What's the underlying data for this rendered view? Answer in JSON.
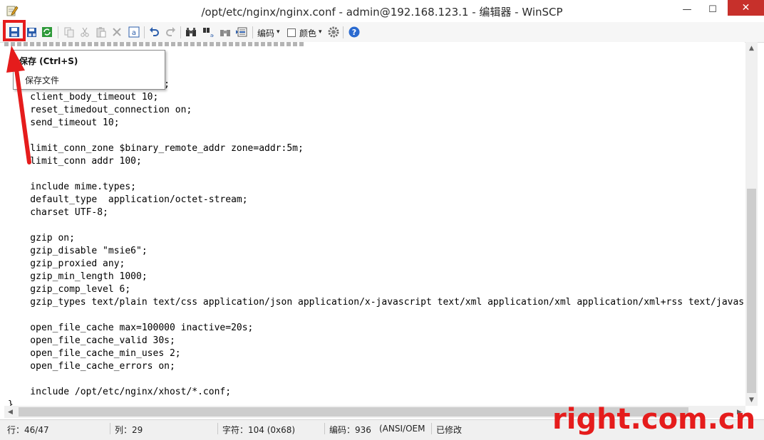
{
  "window": {
    "title": "/opt/etc/nginx/nginx.conf - admin@192.168.123.1 - 编辑器 - WinSCP",
    "minimize_glyph": "—",
    "maximize_glyph": "☐",
    "close_glyph": "✕"
  },
  "toolbar": {
    "icons": [
      "save-icon",
      "save-as-icon",
      "reload-icon",
      "copy-icon",
      "cut-icon",
      "paste-icon",
      "delete-icon",
      "select-all-icon",
      "undo-icon",
      "redo-icon",
      "find-icon",
      "replace-icon",
      "find-next-icon",
      "goto-line-icon",
      "settings-icon",
      "help-icon"
    ],
    "encoding_label": "编码",
    "color_label": "颜色",
    "dropdown_glyph": "▾",
    "accent_color": "#2a5caa"
  },
  "tooltip": {
    "title": "保存 (Ctrl+S)",
    "description": "保存文件"
  },
  "editor": {
    "code": "    client_header_timeout 10;\n    client_body_timeout 10;\n    reset_timedout_connection on;\n    send_timeout 10;\n\n    limit_conn_zone $binary_remote_addr zone=addr:5m;\n    limit_conn addr 100;\n\n    include mime.types;\n    default_type  application/octet-stream;\n    charset UTF-8;\n\n    gzip on;\n    gzip_disable \"msie6\";\n    gzip_proxied any;\n    gzip_min_length 1000;\n    gzip_comp_level 6;\n    gzip_types text/plain text/css application/json application/x-javascript text/xml application/xml application/xml+rss text/javascript;\n\n    open_file_cache max=100000 inactive=20s;\n    open_file_cache_valid 30s;\n    open_file_cache_min_uses 2;\n    open_file_cache_errors on;\n\n    include /opt/etc/nginx/xhost/*.conf;\n}"
  },
  "status": {
    "line": "行：46/47",
    "column": "列：29",
    "char": "字符：104 (0x68)",
    "encoding": "编码：936",
    "codepage": "(ANSI/OEM",
    "modified": "已修改"
  },
  "annotation": {
    "highlight_color": "#e51c1c"
  },
  "watermark": {
    "text": "right.com.cn"
  }
}
